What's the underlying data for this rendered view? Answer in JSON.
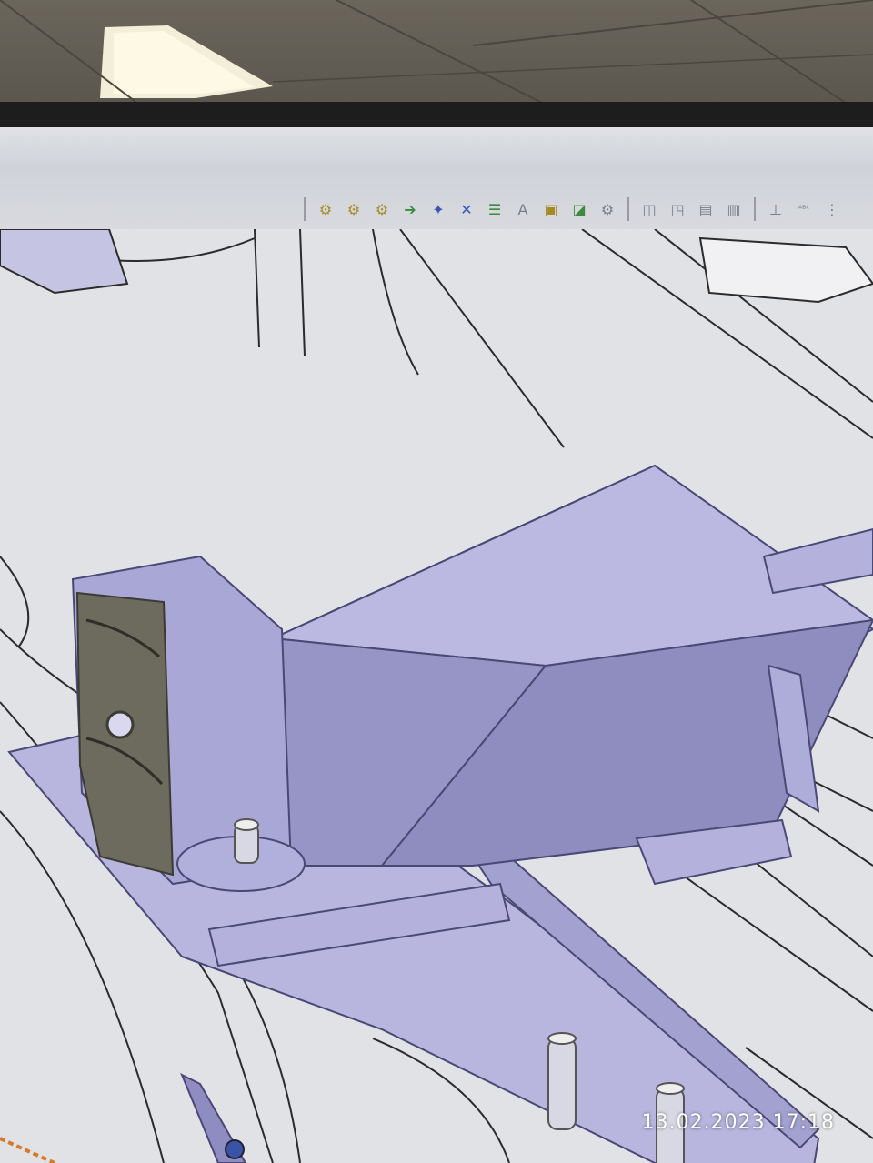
{
  "photo": {
    "timestamp": "13.02.2023  17:18"
  },
  "toolbar": {
    "icons": [
      "gear-multi-icon",
      "gear-settings-icon",
      "gear-catalog-icon",
      "export-icon",
      "part-insert-icon",
      "analysis-icon",
      "table-arrow-icon",
      "text-annotation-icon",
      "layers-icon",
      "scale-icon",
      "tool-dropdown-icon",
      "cube-view-icon",
      "cube-outline-icon",
      "doc-settings-icon",
      "doc-settings-alt-icon",
      "axis-icon",
      "abc-text-icon",
      "more-icon"
    ]
  },
  "colors": {
    "part_fill": "#b5b3de",
    "part_dark": "#8c89bd",
    "rubber": "#6d6b5e",
    "background_lines": "#2a2a2a",
    "background": "#e1e2e6"
  }
}
